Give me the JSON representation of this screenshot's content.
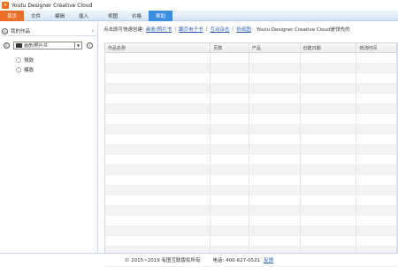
{
  "window": {
    "title": "Youtu Designer Creative Cloud",
    "icon": "app-logo-icon"
  },
  "menu": [
    {
      "label": "首页",
      "state": "active-home"
    },
    {
      "label": "文件",
      "state": ""
    },
    {
      "label": "编辑",
      "state": ""
    },
    {
      "label": "插入",
      "state": ""
    },
    {
      "label": "视图",
      "state": ""
    },
    {
      "label": "价格",
      "state": ""
    },
    {
      "label": "帮助",
      "state": "active-help"
    }
  ],
  "sidebar": {
    "my_works": "我的作品",
    "category_select": "画册/照片书",
    "tree": [
      {
        "label": "预款"
      },
      {
        "label": "模款"
      }
    ]
  },
  "quickbar": {
    "prefix": "点击即可快速创建:",
    "links": [
      "画册/照片书",
      "翻页电子书",
      "互动杂志",
      "折纸图"
    ],
    "note": "Youtu Designer Creative Cloud是领先的"
  },
  "table": {
    "columns": [
      "作品名称",
      "页数",
      "产品",
      "创建日期",
      "修改时间"
    ],
    "row_count": 21
  },
  "footer": {
    "copyright": "© 2015~2019 有图互联版权所有",
    "phone": "电话: 400-627-0521",
    "feedback": "反馈"
  }
}
